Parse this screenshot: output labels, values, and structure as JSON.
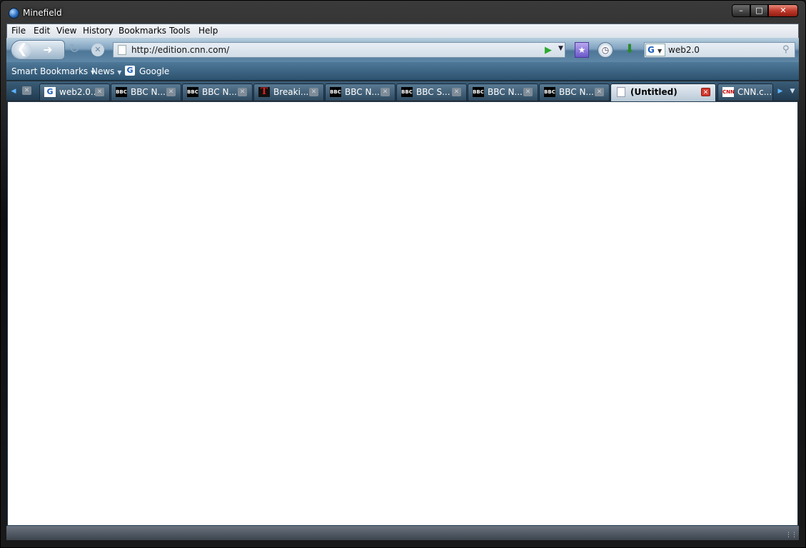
{
  "window": {
    "title": "Minefield"
  },
  "menu": [
    "File",
    "Edit",
    "View",
    "History",
    "Bookmarks",
    "Tools",
    "Help"
  ],
  "nav": {
    "url": "http://edition.cnn.com/",
    "search_engine": "G",
    "search_value": "web2.0"
  },
  "bookmarks": [
    {
      "label": "Smart Bookmarks"
    },
    {
      "label": "News"
    },
    {
      "label": "Google"
    }
  ],
  "tabs": [
    {
      "title": "web2.0...",
      "favicon": "G",
      "selected": false
    },
    {
      "title": "BBC N...",
      "favicon": "BBC",
      "selected": false
    },
    {
      "title": "BBC N...",
      "favicon": "BBC",
      "selected": false
    },
    {
      "title": "Breaki...",
      "favicon": "T",
      "selected": false
    },
    {
      "title": "BBC N...",
      "favicon": "BBC",
      "selected": false
    },
    {
      "title": "BBC S...",
      "favicon": "BBC",
      "selected": false
    },
    {
      "title": "BBC N...",
      "favicon": "BBC",
      "selected": false
    },
    {
      "title": "BBC N...",
      "favicon": "BBC",
      "selected": false
    },
    {
      "title": "(Untitled)",
      "favicon": "page",
      "selected": true
    },
    {
      "title": "CNN.c...",
      "favicon": "CNN",
      "selected": false
    }
  ]
}
